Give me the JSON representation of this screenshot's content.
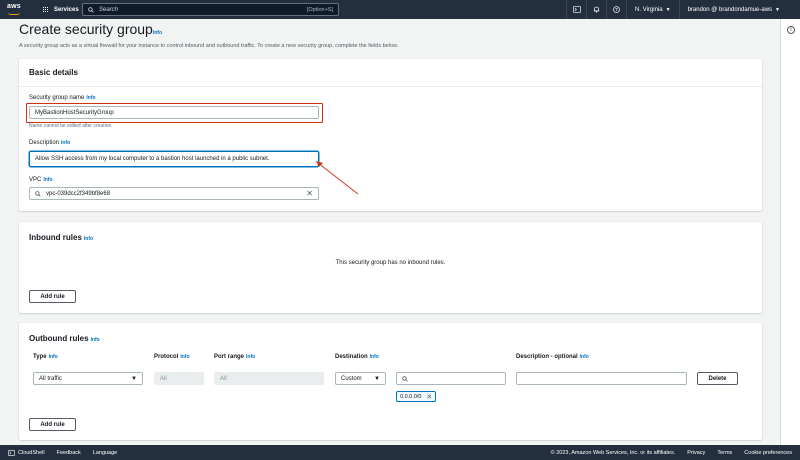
{
  "nav": {
    "logo": "aws",
    "services": "Services",
    "search_placeholder": "Search",
    "search_shortcut": "[Option+S]",
    "region": "N. Virginia",
    "account": "brandon @ brandondamue-aws"
  },
  "page": {
    "title": "Create security group",
    "title_info": "Info",
    "intro": "A security group acts as a virtual firewall for your instance to control inbound and outbound traffic. To create a new security group, complete the fields below."
  },
  "basic": {
    "heading": "Basic details",
    "name_label": "Security group name",
    "name_value": "MyBastionHostSecurityGroup",
    "name_hint": "Name cannot be edited after creation.",
    "desc_label": "Description",
    "desc_value": "Allow SSH access from my local computer to a bastion host launched in a public subnet.",
    "vpc_label": "VPC",
    "vpc_value": "vpc-039dcc2f349bf8e68",
    "info": "Info"
  },
  "inbound": {
    "heading": "Inbound rules",
    "empty": "This security group has no inbound rules.",
    "add_rule": "Add rule"
  },
  "outbound": {
    "heading": "Outbound rules",
    "columns": {
      "type": "Type",
      "protocol": "Protocol",
      "port_range": "Port range",
      "destination": "Destination",
      "description": "Description - optional"
    },
    "row": {
      "type": "All traffic",
      "protocol": "All",
      "port_range": "All",
      "destination": "Custom",
      "cidr": "0.0.0.0/0",
      "delete": "Delete"
    },
    "add_rule": "Add rule"
  },
  "footer": {
    "cloudshell": "CloudShell",
    "feedback": "Feedback",
    "language": "Language",
    "copyright": "© 2023, Amazon Web Services, Inc. or its affiliates.",
    "privacy": "Privacy",
    "terms": "Terms",
    "cookies": "Cookie preferences"
  },
  "colors": {
    "nav_bg": "#232f3e",
    "link": "#0073bb",
    "highlight": "#d13212"
  }
}
